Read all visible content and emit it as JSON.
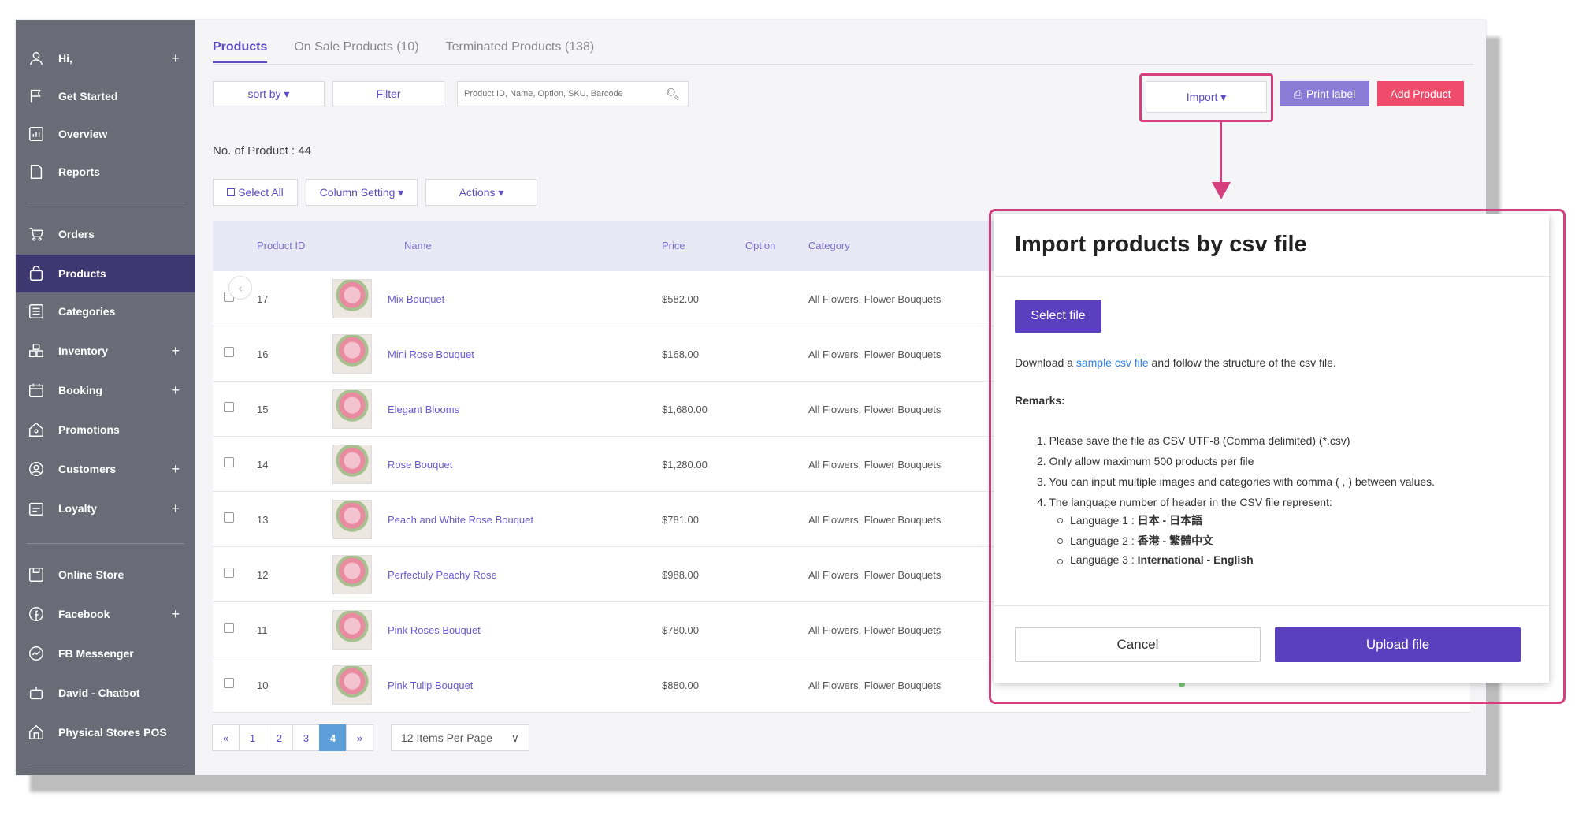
{
  "sidebar": {
    "items": [
      {
        "label": "Hi,",
        "icon": "user-icon",
        "plus": "+"
      },
      {
        "label": "Get Started",
        "icon": "flag-icon",
        "plus": ""
      },
      {
        "label": "Overview",
        "icon": "chart-icon",
        "plus": ""
      },
      {
        "label": "Reports",
        "icon": "document-icon",
        "plus": ""
      },
      {
        "label": "Orders",
        "icon": "cart-icon",
        "plus": ""
      },
      {
        "label": "Products",
        "icon": "bag-icon",
        "plus": ""
      },
      {
        "label": "Categories",
        "icon": "list-icon",
        "plus": ""
      },
      {
        "label": "Inventory",
        "icon": "boxes-icon",
        "plus": "+"
      },
      {
        "label": "Booking",
        "icon": "calendar-icon",
        "plus": "+"
      },
      {
        "label": "Promotions",
        "icon": "tag-icon",
        "plus": ""
      },
      {
        "label": "Customers",
        "icon": "customer-icon",
        "plus": "+"
      },
      {
        "label": "Loyalty",
        "icon": "loyalty-icon",
        "plus": "+"
      },
      {
        "label": "Online Store",
        "icon": "store-icon",
        "plus": ""
      },
      {
        "label": "Facebook",
        "icon": "facebook-icon",
        "plus": "+"
      },
      {
        "label": "FB Messenger",
        "icon": "messenger-icon",
        "plus": ""
      },
      {
        "label": "David - Chatbot",
        "icon": "chatbot-icon",
        "plus": ""
      },
      {
        "label": "Physical Stores POS",
        "icon": "pos-icon",
        "plus": ""
      }
    ]
  },
  "tabs": [
    "Products",
    "On Sale Products (10)",
    "Terminated Products (138)"
  ],
  "toolbar": {
    "sort_label": "sort by ▾",
    "filter_label": "Filter",
    "search_placeholder": "Product ID, Name, Option, SKU, Barcode",
    "import_label": "Import ▾",
    "print_label": "Print label",
    "add_label": "Add Product"
  },
  "count_label": "No. of Product : 44",
  "table_actions": {
    "select_all": "Select All",
    "column_setting": "Column Setting ▾",
    "actions": "Actions ▾"
  },
  "table": {
    "headers": [
      "Product ID",
      "Name",
      "Price",
      "Option",
      "Category"
    ],
    "rows": [
      {
        "id": "17",
        "name": "Mix Bouquet",
        "price": "$582.00",
        "category": "All Flowers, Flower Bouquets"
      },
      {
        "id": "16",
        "name": "Mini Rose Bouquet",
        "price": "$168.00",
        "category": "All Flowers, Flower Bouquets"
      },
      {
        "id": "15",
        "name": "Elegant Blooms",
        "price": "$1,680.00",
        "category": "All Flowers, Flower Bouquets"
      },
      {
        "id": "14",
        "name": "Rose Bouquet",
        "price": "$1,280.00",
        "category": "All Flowers, Flower Bouquets"
      },
      {
        "id": "13",
        "name": "Peach and White Rose Bouquet",
        "price": "$781.00",
        "category": "All Flowers, Flower Bouquets"
      },
      {
        "id": "12",
        "name": "Perfectuly Peachy Rose",
        "price": "$988.00",
        "category": "All Flowers, Flower Bouquets"
      },
      {
        "id": "11",
        "name": "Pink Roses Bouquet",
        "price": "$780.00",
        "category": "All Flowers, Flower Bouquets"
      },
      {
        "id": "10",
        "name": "Pink Tulip Bouquet",
        "price": "$880.00",
        "category": "All Flowers, Flower Bouquets"
      }
    ]
  },
  "pagination": {
    "pages": [
      "«",
      "1",
      "2",
      "3",
      "4",
      "»"
    ],
    "current": "4",
    "per_page": "12 Items Per Page"
  },
  "modal": {
    "title": "Import products by csv file",
    "select_file": "Select file",
    "download_prefix": "Download a ",
    "download_link": "sample csv file",
    "download_suffix": " and follow the structure of the csv file.",
    "remarks_label": "Remarks:",
    "notes": [
      "1. Please save the file as CSV UTF-8 (Comma delimited) (*.csv)",
      "2. Only allow maximum 500 products per file",
      "3. You can input multiple images and categories with comma ( , ) between values.",
      "4. The language number of header in the CSV file represent:"
    ],
    "languages": [
      {
        "prefix": "Language 1 : ",
        "value": "日本 - 日本語"
      },
      {
        "prefix": "Language 2 : ",
        "value": "香港 - 繁體中文"
      },
      {
        "prefix": "Language 3 : ",
        "value": "International - English"
      }
    ],
    "cancel_label": "Cancel",
    "upload_label": "Upload file"
  },
  "colors": {
    "sidebar": "#6a6b76",
    "sidebar_active": "#3f376f",
    "accent": "#5a3fbf",
    "highlight": "#d63f7e",
    "add_button": "#ef4b6b"
  }
}
